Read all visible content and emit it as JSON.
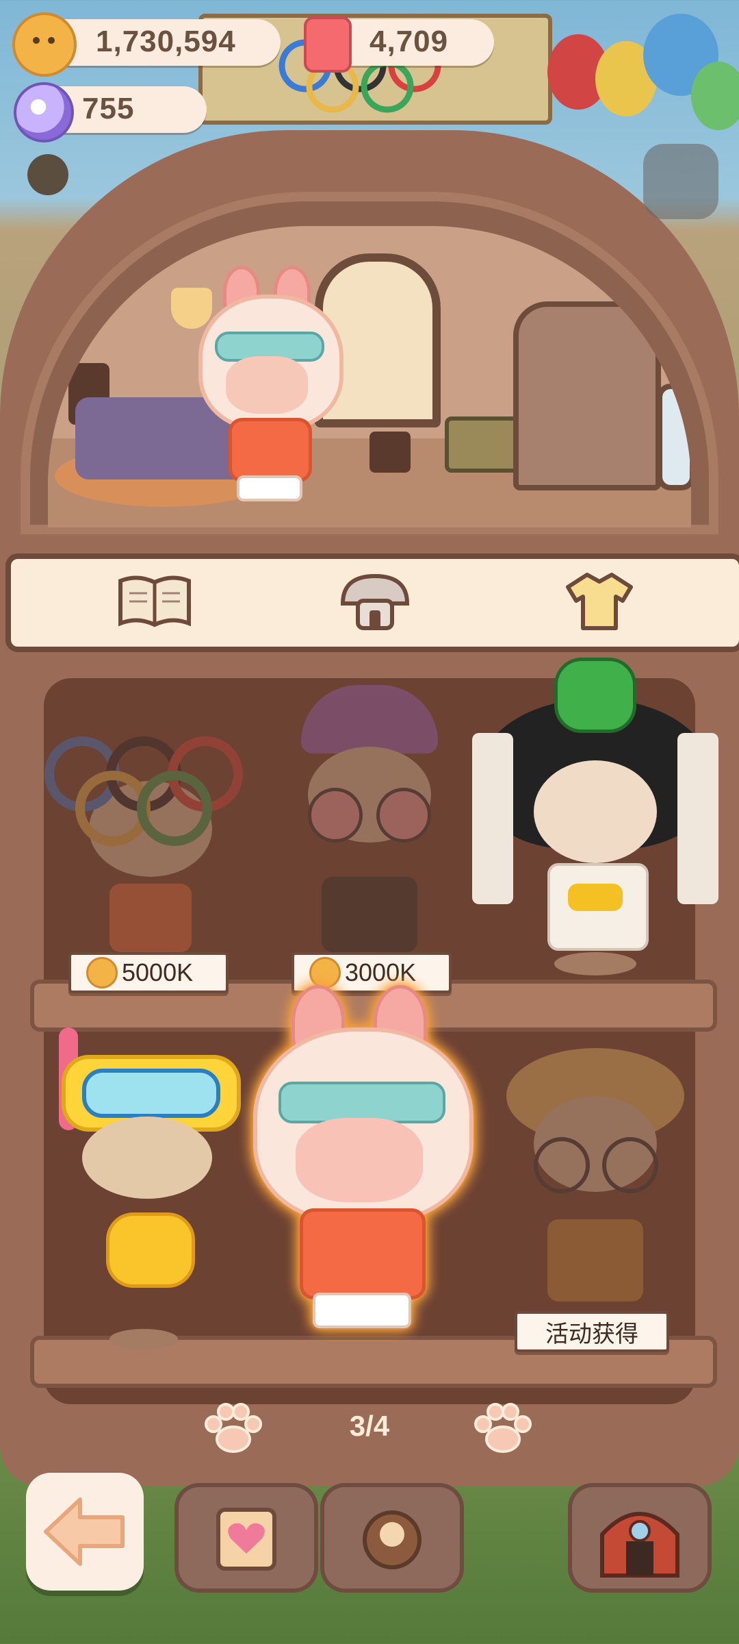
{
  "currencies": {
    "coins": {
      "icon": "cookie-coin-icon",
      "value": "1,730,594"
    },
    "gems": {
      "icon": "red-gem-icon",
      "value": "4,709"
    },
    "candy": {
      "icon": "candy-icon",
      "value": "755"
    }
  },
  "tabs": [
    {
      "name": "tab-book",
      "icon": "book-icon",
      "selected": false
    },
    {
      "name": "tab-hotel",
      "icon": "hotel-icon",
      "selected": false
    },
    {
      "name": "tab-outfit",
      "icon": "shirt-icon",
      "selected": true
    }
  ],
  "outfits": [
    {
      "name": "outfit-olympic",
      "state": "locked",
      "price": "5000K"
    },
    {
      "name": "outfit-punk-glasses",
      "state": "locked",
      "price": "3000K"
    },
    {
      "name": "outfit-snake-empress",
      "state": "owned"
    },
    {
      "name": "outfit-snorkel-duck",
      "state": "owned"
    },
    {
      "name": "outfit-astronaut-bunny",
      "state": "equipped"
    },
    {
      "name": "outfit-detective",
      "state": "locked",
      "event_label": "活动获得"
    }
  ],
  "pager": {
    "text": "3/4",
    "current": 3,
    "total": 4
  },
  "dock": [
    {
      "name": "diary-button",
      "icon": "heart-notebook-icon"
    },
    {
      "name": "cafe-button",
      "icon": "cafe-icon"
    },
    {
      "name": "circus-button",
      "icon": "circus-tent-icon"
    }
  ],
  "colors": {
    "wood": "#9a6c58",
    "shelf_interior": "#6c4233",
    "tab_background": "#fbecd9",
    "selection_glow": "#f7a23a"
  }
}
